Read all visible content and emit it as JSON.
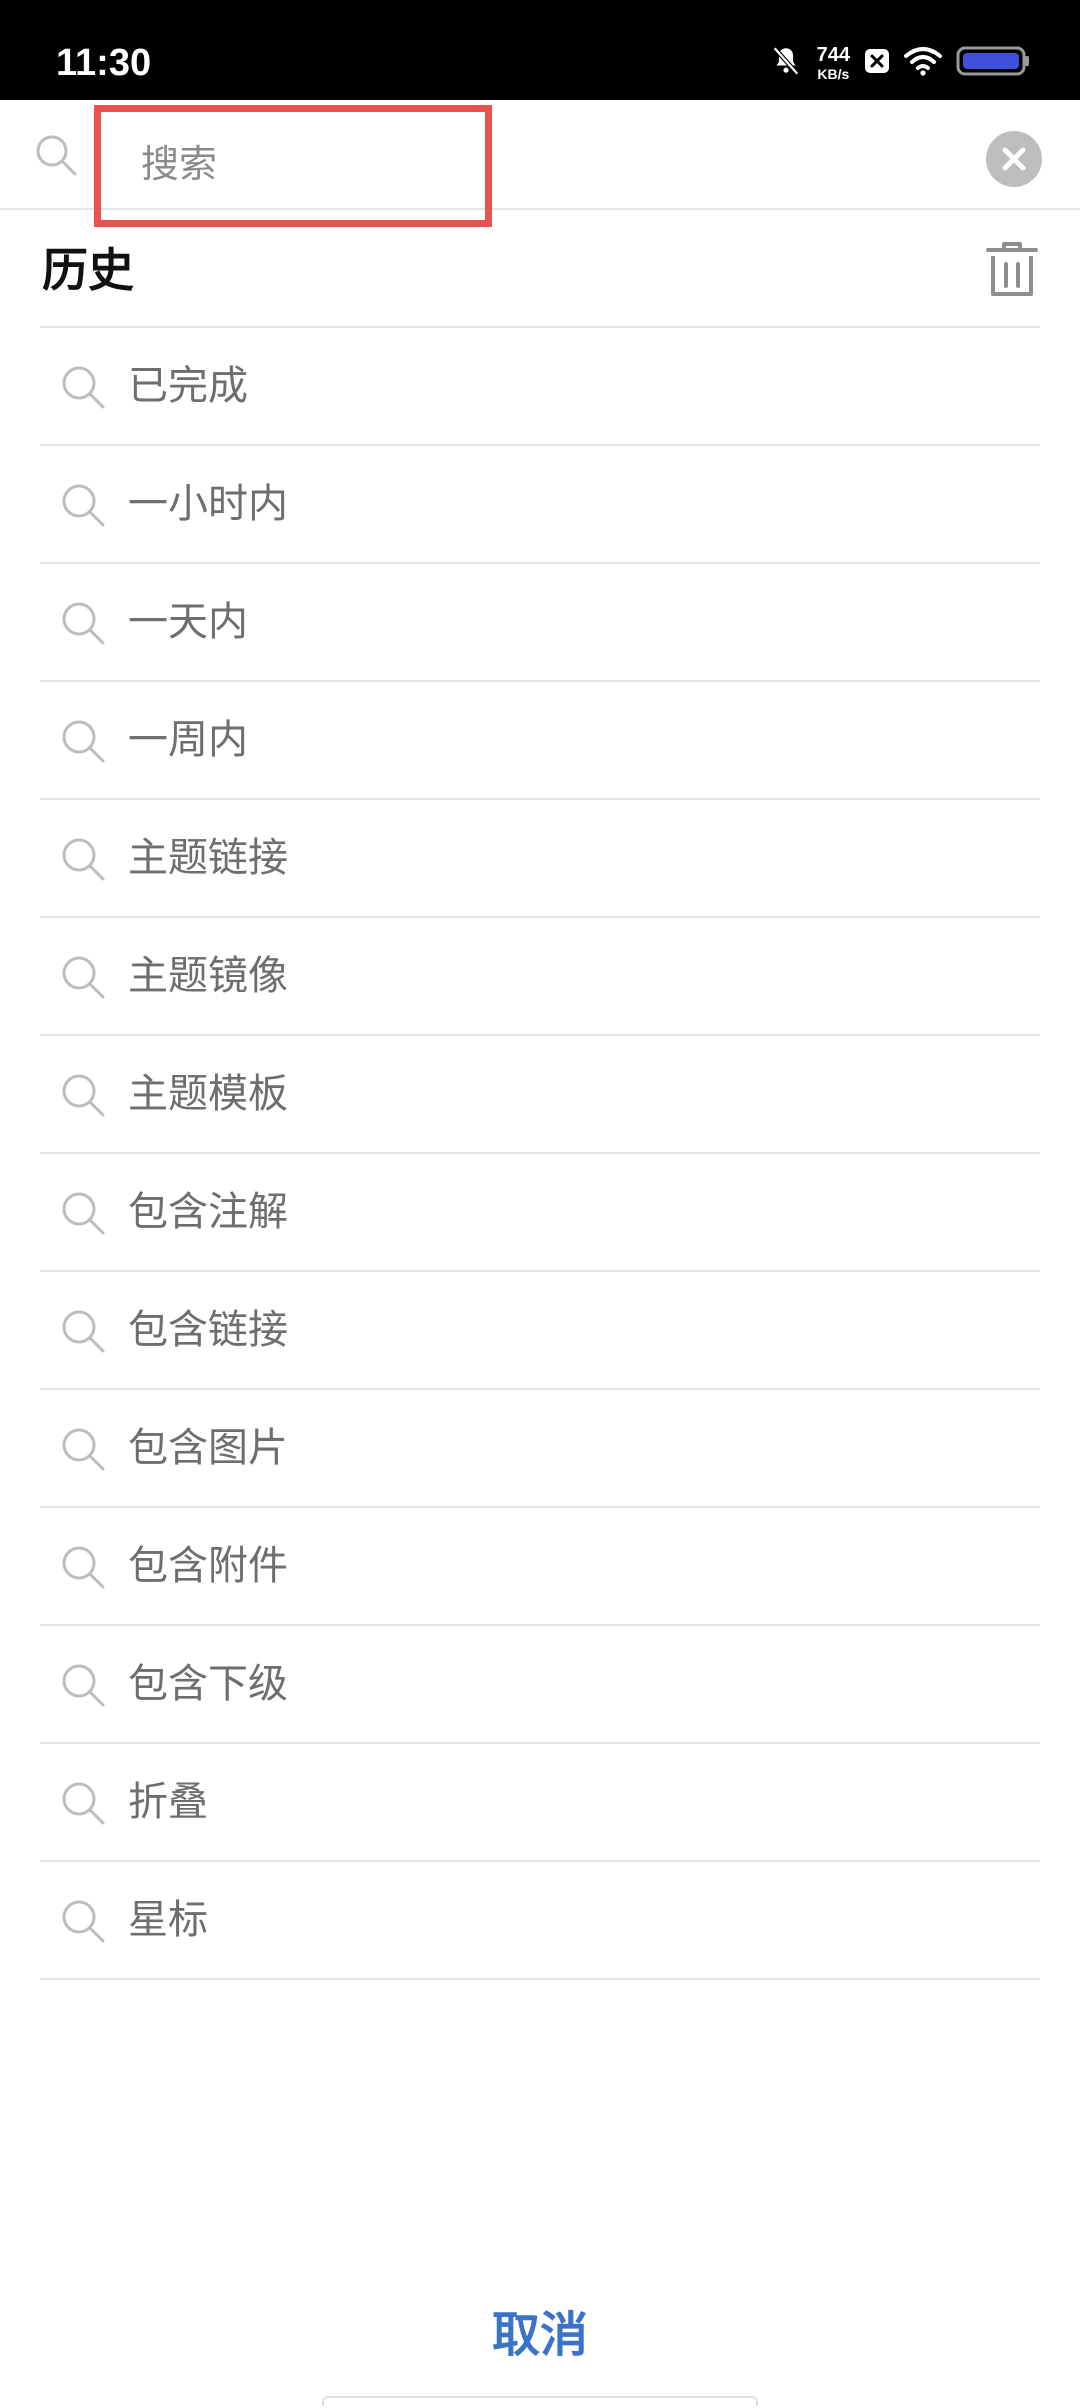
{
  "status_bar": {
    "time": "11:30",
    "net_speed_value": "744",
    "net_speed_unit": "KB/s",
    "icons": [
      "bell-muted-icon",
      "x-box-icon",
      "wifi-icon",
      "battery-icon"
    ]
  },
  "search": {
    "placeholder": "搜索",
    "value": ""
  },
  "history": {
    "title": "历史",
    "items": [
      {
        "label": "已完成"
      },
      {
        "label": "一小时内"
      },
      {
        "label": "一天内"
      },
      {
        "label": "一周内"
      },
      {
        "label": "主题链接"
      },
      {
        "label": "主题镜像"
      },
      {
        "label": "主题模板"
      },
      {
        "label": "包含注解"
      },
      {
        "label": "包含链接"
      },
      {
        "label": "包含图片"
      },
      {
        "label": "包含附件"
      },
      {
        "label": "包含下级"
      },
      {
        "label": "折叠"
      },
      {
        "label": "星标"
      }
    ]
  },
  "footer": {
    "cancel_label": "取消"
  },
  "colors": {
    "accent": "#3a74c9",
    "highlight_border": "#e8524f",
    "item_text": "#6e6e6e",
    "divider": "#e3e3e3"
  }
}
